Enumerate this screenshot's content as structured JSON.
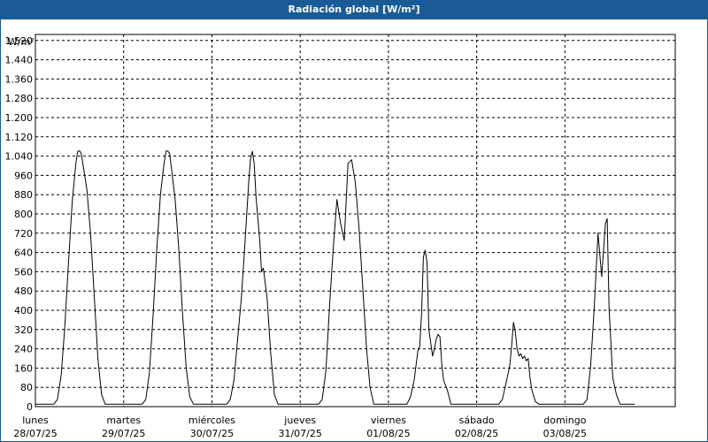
{
  "window": {
    "title": "Radiación global [W/m²]"
  },
  "chart_data": {
    "type": "line",
    "title": "Radiación global [W/m²]",
    "ylabel": "W/m²",
    "xlabel": "",
    "ylim": [
      0,
      1600
    ],
    "yticks": [
      0,
      80,
      160,
      240,
      320,
      400,
      480,
      560,
      640,
      720,
      800,
      880,
      960,
      1040,
      1120,
      1200,
      1280,
      1360,
      1440,
      1520
    ],
    "ytick_labels": [
      "0",
      "80",
      "160",
      "240",
      "320",
      "400",
      "480",
      "560",
      "640",
      "720",
      "800",
      "880",
      "960",
      "1.040",
      "1.120",
      "1.200",
      "1.280",
      "1.360",
      "1.440",
      "1.520"
    ],
    "xlim_hours": [
      0,
      174
    ],
    "day_labels": [
      {
        "day": "lunes",
        "date": "28/07/25",
        "hour": 0
      },
      {
        "day": "martes",
        "date": "29/07/25",
        "hour": 24
      },
      {
        "day": "miércoles",
        "date": "30/07/25",
        "hour": 48
      },
      {
        "day": "jueves",
        "date": "31/07/25",
        "hour": 72
      },
      {
        "day": "viernes",
        "date": "01/08/25",
        "hour": 96
      },
      {
        "day": "sábado",
        "date": "02/08/25",
        "hour": 120
      },
      {
        "day": "domingo",
        "date": "03/08/25",
        "hour": 144
      }
    ],
    "grid": true,
    "series": [
      {
        "color": "#000000",
        "points": [
          [
            0,
            10
          ],
          [
            5,
            10
          ],
          [
            6,
            30
          ],
          [
            7,
            130
          ],
          [
            8,
            330
          ],
          [
            9,
            600
          ],
          [
            10,
            850
          ],
          [
            11,
            1010
          ],
          [
            11.5,
            1060
          ],
          [
            12,
            1062
          ],
          [
            12.5,
            1050
          ],
          [
            13,
            1000
          ],
          [
            14,
            900
          ],
          [
            15,
            720
          ],
          [
            16,
            460
          ],
          [
            17,
            200
          ],
          [
            18,
            50
          ],
          [
            19,
            10
          ],
          [
            29,
            10
          ],
          [
            30,
            30
          ],
          [
            31,
            140
          ],
          [
            32,
            380
          ],
          [
            33,
            650
          ],
          [
            34,
            880
          ],
          [
            35,
            1010
          ],
          [
            35.5,
            1060
          ],
          [
            36,
            1062
          ],
          [
            36.5,
            1050
          ],
          [
            37,
            990
          ],
          [
            38,
            860
          ],
          [
            39,
            650
          ],
          [
            40,
            390
          ],
          [
            41,
            160
          ],
          [
            42,
            40
          ],
          [
            43,
            10
          ],
          [
            52,
            10
          ],
          [
            53,
            30
          ],
          [
            54,
            110
          ],
          [
            55,
            280
          ],
          [
            56,
            450
          ],
          [
            57,
            680
          ],
          [
            58,
            930
          ],
          [
            58.5,
            1030
          ],
          [
            59,
            1060
          ],
          [
            59.5,
            1010
          ],
          [
            60,
            870
          ],
          [
            61,
            690
          ],
          [
            61.5,
            560
          ],
          [
            62,
            575
          ],
          [
            63,
            450
          ],
          [
            64,
            220
          ],
          [
            65,
            50
          ],
          [
            66,
            10
          ],
          [
            77,
            10
          ],
          [
            78,
            30
          ],
          [
            79,
            150
          ],
          [
            80,
            420
          ],
          [
            81,
            660
          ],
          [
            82,
            860
          ],
          [
            83,
            760
          ],
          [
            84,
            690
          ],
          [
            84.5,
            850
          ],
          [
            85,
            1010
          ],
          [
            86,
            1025
          ],
          [
            87,
            930
          ],
          [
            88,
            740
          ],
          [
            89,
            500
          ],
          [
            90,
            250
          ],
          [
            91,
            80
          ],
          [
            92,
            10
          ],
          [
            101,
            10
          ],
          [
            102,
            40
          ],
          [
            103,
            110
          ],
          [
            104,
            230
          ],
          [
            104.5,
            250
          ],
          [
            105,
            380
          ],
          [
            105.5,
            620
          ],
          [
            106,
            650
          ],
          [
            106.5,
            600
          ],
          [
            107,
            320
          ],
          [
            108,
            210
          ],
          [
            108.5,
            240
          ],
          [
            109,
            280
          ],
          [
            109.5,
            300
          ],
          [
            110,
            290
          ],
          [
            110.5,
            180
          ],
          [
            111,
            110
          ],
          [
            112,
            70
          ],
          [
            113,
            10
          ],
          [
            126,
            10
          ],
          [
            127,
            30
          ],
          [
            128,
            100
          ],
          [
            129,
            170
          ],
          [
            129.5,
            250
          ],
          [
            130,
            350
          ],
          [
            130.5,
            310
          ],
          [
            131,
            240
          ],
          [
            131.5,
            210
          ],
          [
            132,
            220
          ],
          [
            132.5,
            200
          ],
          [
            133,
            210
          ],
          [
            133.5,
            190
          ],
          [
            134,
            200
          ],
          [
            134.5,
            120
          ],
          [
            135,
            70
          ],
          [
            136,
            20
          ],
          [
            137,
            10
          ],
          [
            149,
            10
          ],
          [
            150,
            30
          ],
          [
            151,
            170
          ],
          [
            152,
            420
          ],
          [
            153,
            720
          ],
          [
            154,
            540
          ],
          [
            155,
            760
          ],
          [
            155.5,
            780
          ],
          [
            156,
            410
          ],
          [
            157,
            120
          ],
          [
            158,
            50
          ],
          [
            159,
            10
          ],
          [
            163,
            10
          ]
        ]
      }
    ]
  }
}
